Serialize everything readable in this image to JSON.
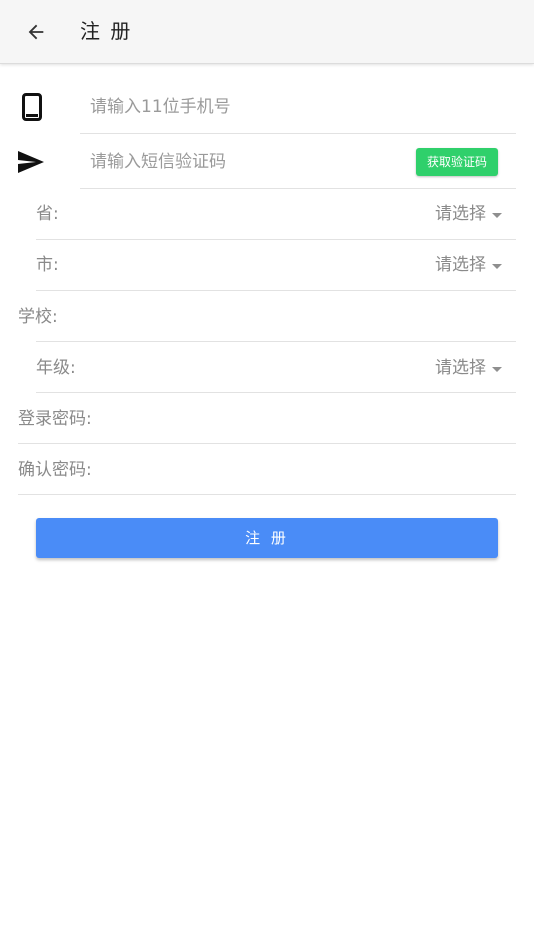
{
  "appbar": {
    "title": "注 册",
    "back_icon": "arrow-left-icon"
  },
  "phone": {
    "icon": "smartphone-icon",
    "placeholder": "请输入11位手机号",
    "value": ""
  },
  "sms": {
    "icon": "send-icon",
    "placeholder": "请输入短信验证码",
    "value": "",
    "button_label": "获取验证码",
    "button_color": "#2fd06b"
  },
  "province": {
    "label": "省:",
    "select_text": "请选择"
  },
  "city": {
    "label": "市:",
    "select_text": "请选择"
  },
  "school": {
    "label": "学校:",
    "value": ""
  },
  "grade": {
    "label": "年级:",
    "select_text": "请选择"
  },
  "password": {
    "label": "登录密码:",
    "value": ""
  },
  "confirm_password": {
    "label": "确认密码:",
    "value": ""
  },
  "submit": {
    "label": "注 册",
    "color": "#4a8cf7"
  }
}
